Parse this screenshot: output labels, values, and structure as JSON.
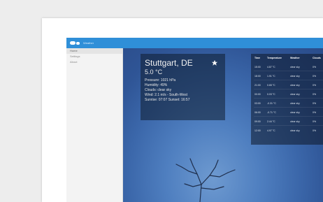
{
  "app": {
    "name": "Weather"
  },
  "sidebar": {
    "items": [
      {
        "label": "Home"
      },
      {
        "label": "Settings"
      },
      {
        "label": "About"
      }
    ]
  },
  "location": {
    "city": "Stuttgart, DE",
    "temperature": "5.0 °C",
    "details": [
      "Pressure: 1021 hPa",
      "Humidity: 49%",
      "Clouds: clear sky",
      "Wind: 2.1 m/s - South-West",
      "Sunrise: 07:07 Sunset: 16:57"
    ]
  },
  "forecast": {
    "headers": [
      "Time",
      "Temperature",
      "Weather",
      "Clouds"
    ],
    "rows": [
      [
        "15:00",
        "4.87 °C",
        "clear sky",
        "0%"
      ],
      [
        "18:00",
        "1.91 °C",
        "clear sky",
        "0%"
      ],
      [
        "21:00",
        "0.65 °C",
        "clear sky",
        "0%"
      ],
      [
        "00:00",
        "0.03 °C",
        "clear sky",
        "0%"
      ],
      [
        "03:00",
        "-0.31 °C",
        "clear sky",
        "0%"
      ],
      [
        "06:00",
        "-0.71 °C",
        "clear sky",
        "0%"
      ],
      [
        "09:00",
        "2.44 °C",
        "clear sky",
        "0%"
      ],
      [
        "12:00",
        "4.97 °C",
        "clear sky",
        "0%"
      ]
    ]
  },
  "colors": {
    "topbar": "#2f8fd8",
    "panel_bg": "rgba(14,24,40,0.52)",
    "sky": "#3b67aa"
  }
}
